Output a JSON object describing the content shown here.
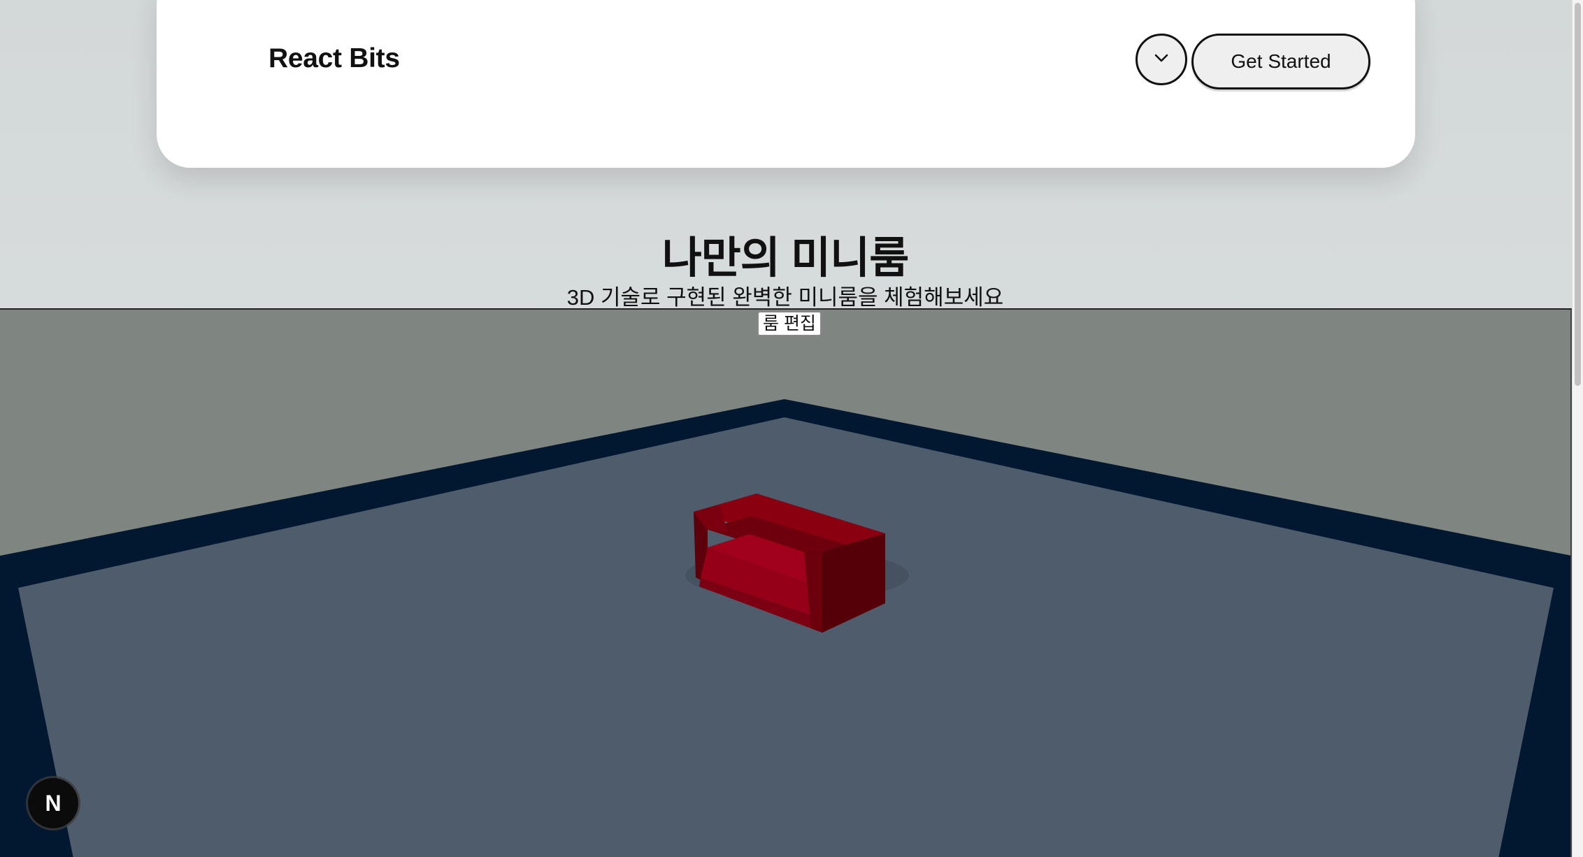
{
  "header": {
    "brand": "React Bits",
    "toggle_icon": "chevron-down-icon",
    "cta_label": "Get Started"
  },
  "hero": {
    "title": "나만의 미니룸",
    "subtitle": "3D 기술로 구현된 완벽한 미니룸을 체험해보세요"
  },
  "scene": {
    "edit_button_label": "룸 편집",
    "wall_color": "#7f8580",
    "floor_color": "#4e5c6c",
    "floor_border_color": "#021730",
    "sofa_color": "#a0001a"
  },
  "dev_badge": {
    "label": "N"
  }
}
